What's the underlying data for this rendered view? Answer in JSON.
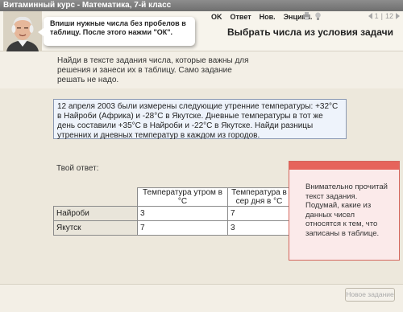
{
  "window": {
    "title": "Витаминный курс - Математика, 7-й класс"
  },
  "toolbar": {
    "menu": [
      "OK",
      "Ответ",
      "Нов.",
      "Энцикл."
    ],
    "icons": [
      "printer-icon",
      "lightbulb-icon"
    ],
    "pager": {
      "current": "1",
      "separator": "|",
      "total": "12"
    }
  },
  "bubble": {
    "text": "Впиши нужные числа без пробелов в таблицу. После этого нажми \"ОК\"."
  },
  "heading": "Выбрать числа из условия задачи",
  "instructions": "Найди в тексте задания числа, которые важны для решения и занеси их в таблицу. Само задание решать не надо.",
  "problem": "12 апреля 2003 были измерены следующие утренние температуры: +32°C в Найроби (Африка) и -28°C в Якутске. Дневные температуры в тот же день составили +35°C в Найроби и -22°C в Якутске. Найди разницы утренних и дневных температур в каждом из городов.",
  "answer": {
    "label": "Твой ответ:",
    "headers": [
      "Температура утром в °C",
      "Температура в сер дня в °C"
    ],
    "rows": [
      {
        "city": "Найроби",
        "morning": "3",
        "day": "7"
      },
      {
        "city": "Якутск",
        "morning": "7",
        "day": "3"
      }
    ]
  },
  "hint": {
    "text": "Внимательно прочитай текст задания. Подумай, какие из данных чисел относятся к тем, что записаны в таблице."
  },
  "footer": {
    "next_button": "Новое задание"
  },
  "colors": {
    "hint_accent": "#e6645b",
    "problem_border": "#8a98b2",
    "titlebar": "#7d7d7d"
  }
}
